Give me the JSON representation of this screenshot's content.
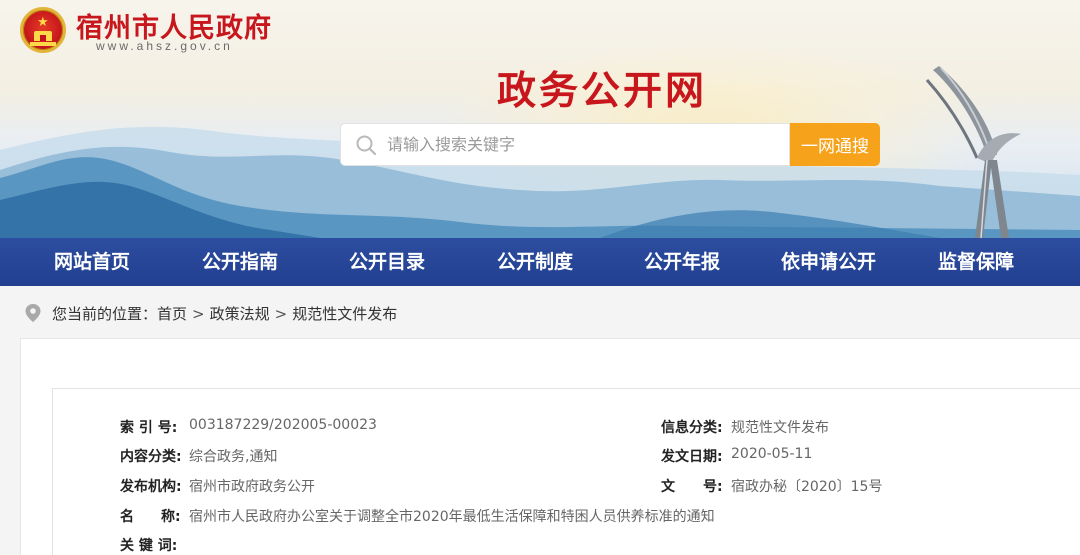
{
  "header": {
    "site_name": "宿州市人民政府",
    "site_url": "www.ahsz.gov.cn",
    "portal_title": "政务公开网"
  },
  "search": {
    "placeholder": "请输入搜索关键字",
    "button_label": "一网通搜"
  },
  "nav": {
    "items": [
      {
        "label": "网站首页"
      },
      {
        "label": "公开指南"
      },
      {
        "label": "公开目录"
      },
      {
        "label": "公开制度"
      },
      {
        "label": "公开年报"
      },
      {
        "label": "依申请公开"
      },
      {
        "label": "监督保障"
      }
    ]
  },
  "breadcrumb": {
    "prefix": "您当前的位置：",
    "items": [
      "首页",
      "政策法规",
      "规范性文件发布"
    ],
    "separator": ">"
  },
  "info": {
    "index_label": "索 引 号:",
    "index_value": "003187229/202005-00023",
    "category_label": "信息分类:",
    "category_value": "规范性文件发布",
    "content_type_label": "内容分类:",
    "content_type_value": "综合政务,通知",
    "date_label": "发文日期:",
    "date_value": "2020-05-11",
    "publisher_label": "发布机构:",
    "publisher_value": "宿州市政府政务公开",
    "doc_no_label_1": "文",
    "doc_no_label_2": "号:",
    "doc_no_value": "宿政办秘〔2020〕15号",
    "name_label_1": "名",
    "name_label_2": "称:",
    "name_value": "宿州市人民政府办公室关于调整全市2020年最低生活保障和特困人员供养标准的通知",
    "keywords_label": "关 键 词:"
  },
  "colors": {
    "brand_red": "#c8161d",
    "nav_blue": "#223f90",
    "search_orange": "#f7a21b"
  }
}
